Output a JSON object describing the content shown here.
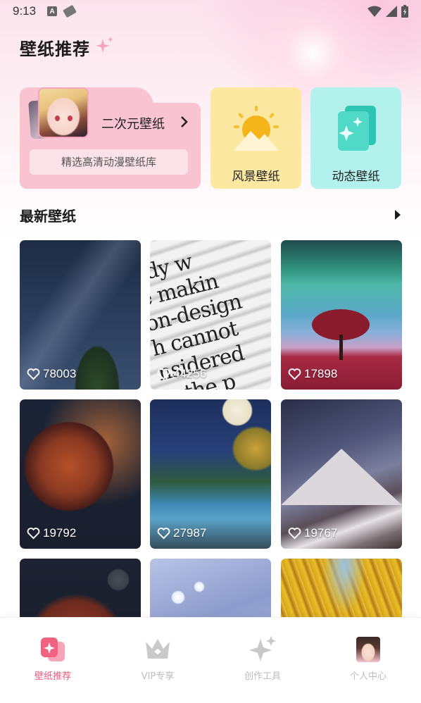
{
  "status_bar": {
    "time": "9:13",
    "a_icon_label": "A"
  },
  "header": {
    "title": "壁纸推荐"
  },
  "categories": {
    "anime": {
      "label": "二次元壁纸",
      "subtitle": "精选高清动漫壁纸库"
    },
    "scenery": {
      "label": "风景壁纸"
    },
    "live": {
      "label": "动态壁纸"
    }
  },
  "latest": {
    "title": "最新壁纸",
    "items": [
      {
        "likes": "78003"
      },
      {
        "likes": "44256",
        "text": "ody w\ne makin\non-design\nh cannot\nnsidered\n's the p"
      },
      {
        "likes": "17898"
      },
      {
        "likes": "19792"
      },
      {
        "likes": "27987"
      },
      {
        "likes": "19767"
      }
    ]
  },
  "bottom_nav": {
    "items": [
      {
        "label": "壁纸推荐",
        "active": true
      },
      {
        "label": "VIP专享",
        "active": false
      },
      {
        "label": "创作工具",
        "active": false
      },
      {
        "label": "个人中心",
        "active": false
      }
    ]
  },
  "colors": {
    "accent_pink": "#f05a7e",
    "anime_card": "#f9c3d2",
    "scenery_card": "#fde8a2",
    "live_card": "#b3f2ec"
  }
}
